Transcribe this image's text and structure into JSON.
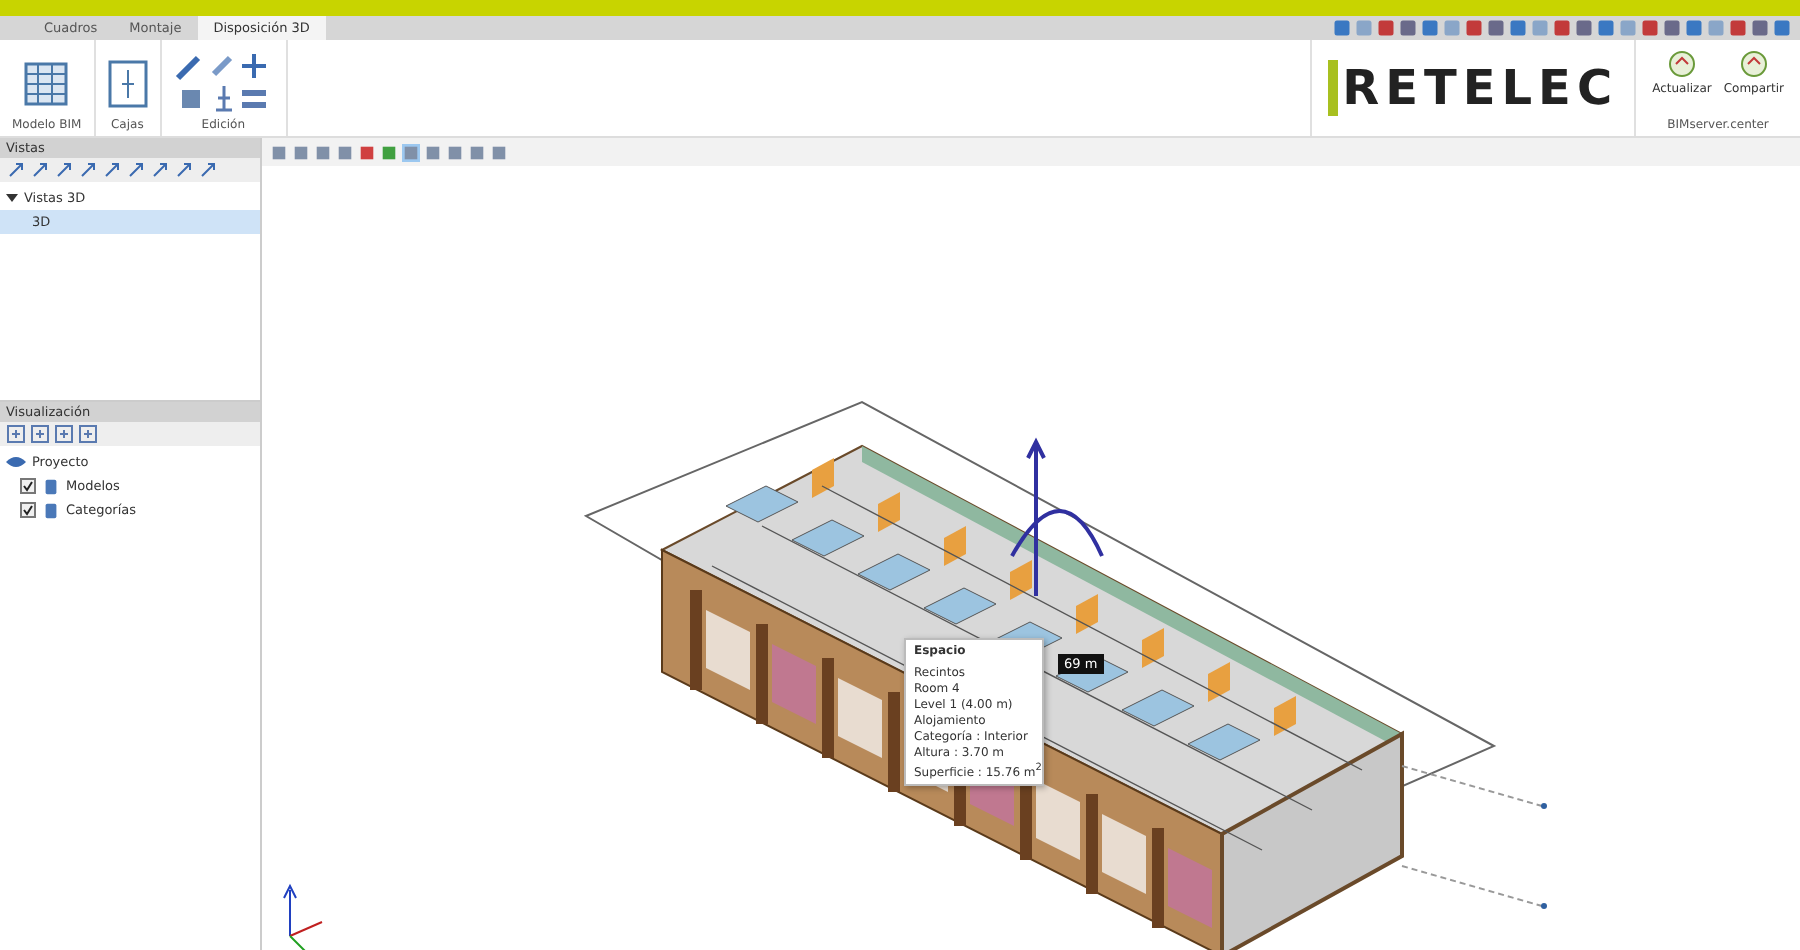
{
  "tabs": [
    {
      "label": "Cuadros",
      "selected": false
    },
    {
      "label": "Montaje",
      "selected": false
    },
    {
      "label": "Disposición 3D",
      "selected": true
    }
  ],
  "ribbon": {
    "groups": [
      {
        "label": "Modelo BIM",
        "kind": "grid"
      },
      {
        "label": "Cajas",
        "kind": "box"
      },
      {
        "label": "Edición",
        "kind": "tools"
      }
    ],
    "logo": "RETELEC",
    "actions": [
      {
        "label": "Actualizar"
      },
      {
        "label": "Compartir"
      }
    ],
    "actions_group": "BIMserver.center"
  },
  "views_panel": {
    "title": "Vistas",
    "tree": [
      {
        "label": "Vistas 3D",
        "expanded": true,
        "children": [
          {
            "label": "3D",
            "selected": true
          }
        ]
      }
    ]
  },
  "display_panel": {
    "title": "Visualización",
    "tree": [
      {
        "label": "Proyecto",
        "children": [
          {
            "label": "Modelos",
            "checked": true
          },
          {
            "label": "Categorías",
            "checked": true
          }
        ]
      }
    ]
  },
  "viewport": {
    "dimension": "69 m",
    "tooltip": {
      "title": "Espacio",
      "lines": [
        "Recintos",
        "Room 4",
        "Level 1 (4.00 m)",
        "Alojamiento",
        "Categoría : Interior",
        "Altura : 3.70 m"
      ],
      "area": "Superficie : 15.76 m$^{2}$"
    }
  }
}
